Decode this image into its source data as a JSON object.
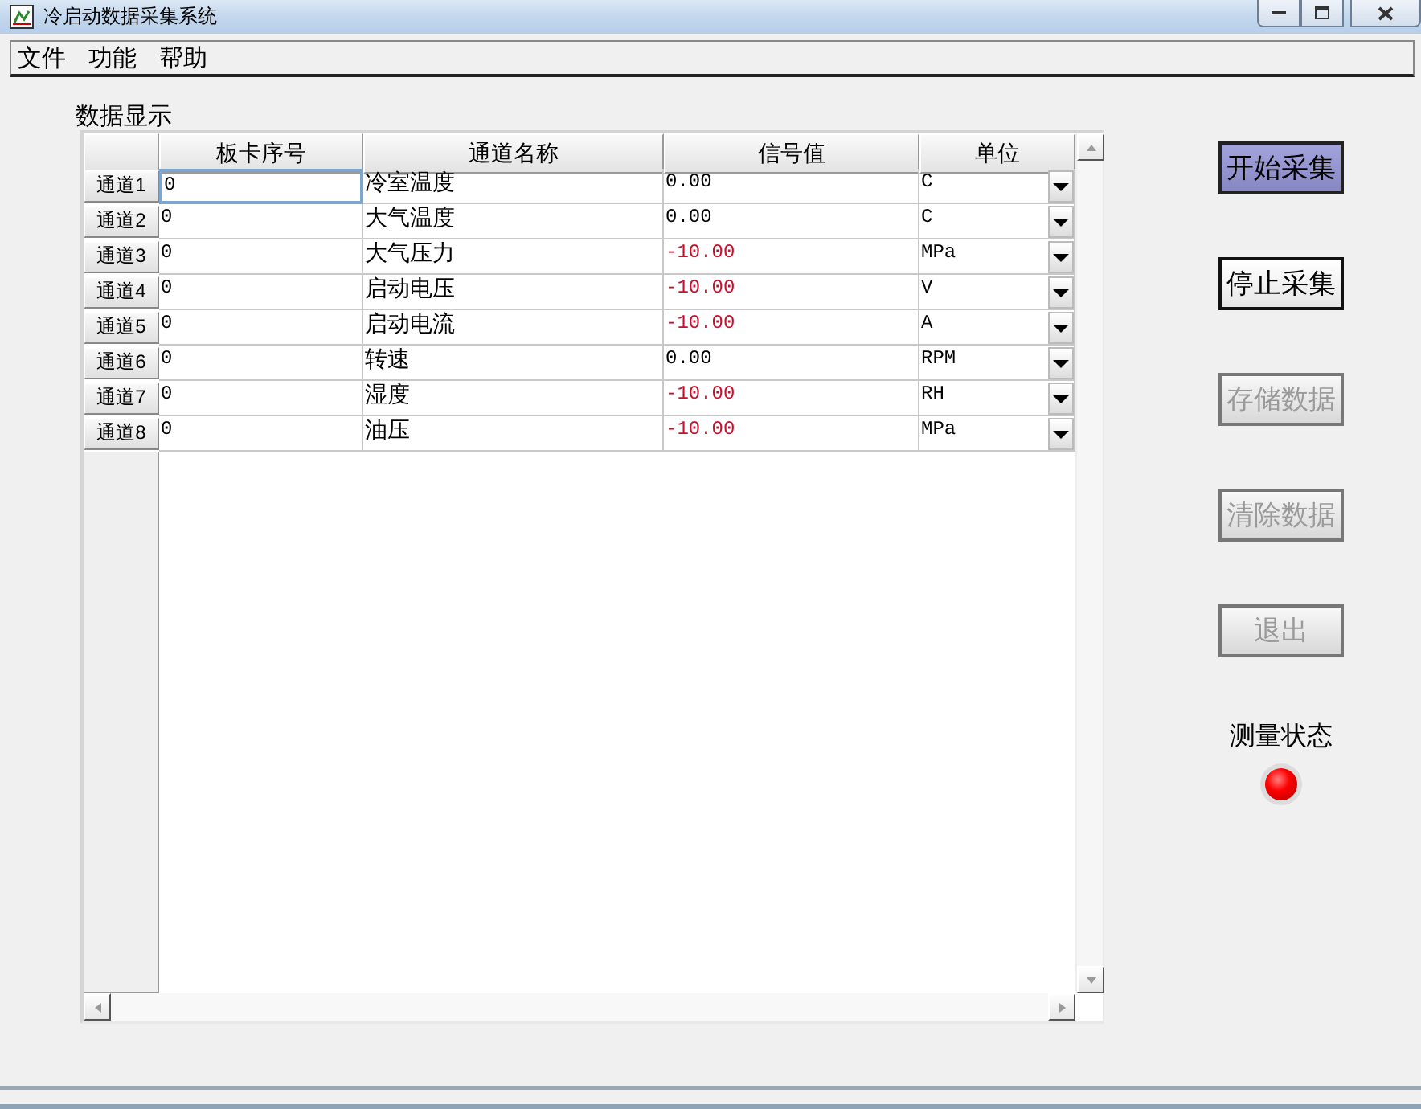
{
  "window": {
    "title": "冷启动数据采集系统"
  },
  "menu": [
    "文件",
    "功能",
    "帮助"
  ],
  "section_label": "数据显示",
  "table": {
    "columns": [
      "板卡序号",
      "通道名称",
      "信号值",
      "单位"
    ],
    "rows": [
      {
        "header": "通道1",
        "board": "0",
        "name": "冷室温度",
        "value": "0.00",
        "alarm": false,
        "unit": "C",
        "selected": true
      },
      {
        "header": "通道2",
        "board": "0",
        "name": "大气温度",
        "value": "0.00",
        "alarm": false,
        "unit": "C",
        "selected": false
      },
      {
        "header": "通道3",
        "board": "0",
        "name": "大气压力",
        "value": "-10.00",
        "alarm": true,
        "unit": "MPa",
        "selected": false
      },
      {
        "header": "通道4",
        "board": "0",
        "name": "启动电压",
        "value": "-10.00",
        "alarm": true,
        "unit": "V",
        "selected": false
      },
      {
        "header": "通道5",
        "board": "0",
        "name": "启动电流",
        "value": "-10.00",
        "alarm": true,
        "unit": "A",
        "selected": false
      },
      {
        "header": "通道6",
        "board": "0",
        "name": "转速",
        "value": "0.00",
        "alarm": false,
        "unit": "RPM",
        "selected": false
      },
      {
        "header": "通道7",
        "board": "0",
        "name": "湿度",
        "value": "-10.00",
        "alarm": true,
        "unit": "RH",
        "selected": false
      },
      {
        "header": "通道8",
        "board": "0",
        "name": "油压",
        "value": "-10.00",
        "alarm": true,
        "unit": "MPa",
        "selected": false
      }
    ]
  },
  "buttons": [
    {
      "label": "开始采集",
      "highlighted": true,
      "focused": false,
      "disabled": false
    },
    {
      "label": "停止采集",
      "highlighted": false,
      "focused": true,
      "disabled": false
    },
    {
      "label": "存储数据",
      "highlighted": false,
      "focused": false,
      "disabled": true
    },
    {
      "label": "清除数据",
      "highlighted": false,
      "focused": false,
      "disabled": true
    },
    {
      "label": "退出",
      "highlighted": false,
      "focused": false,
      "disabled": true
    }
  ],
  "indicator": {
    "label": "测量状态",
    "on": true
  }
}
